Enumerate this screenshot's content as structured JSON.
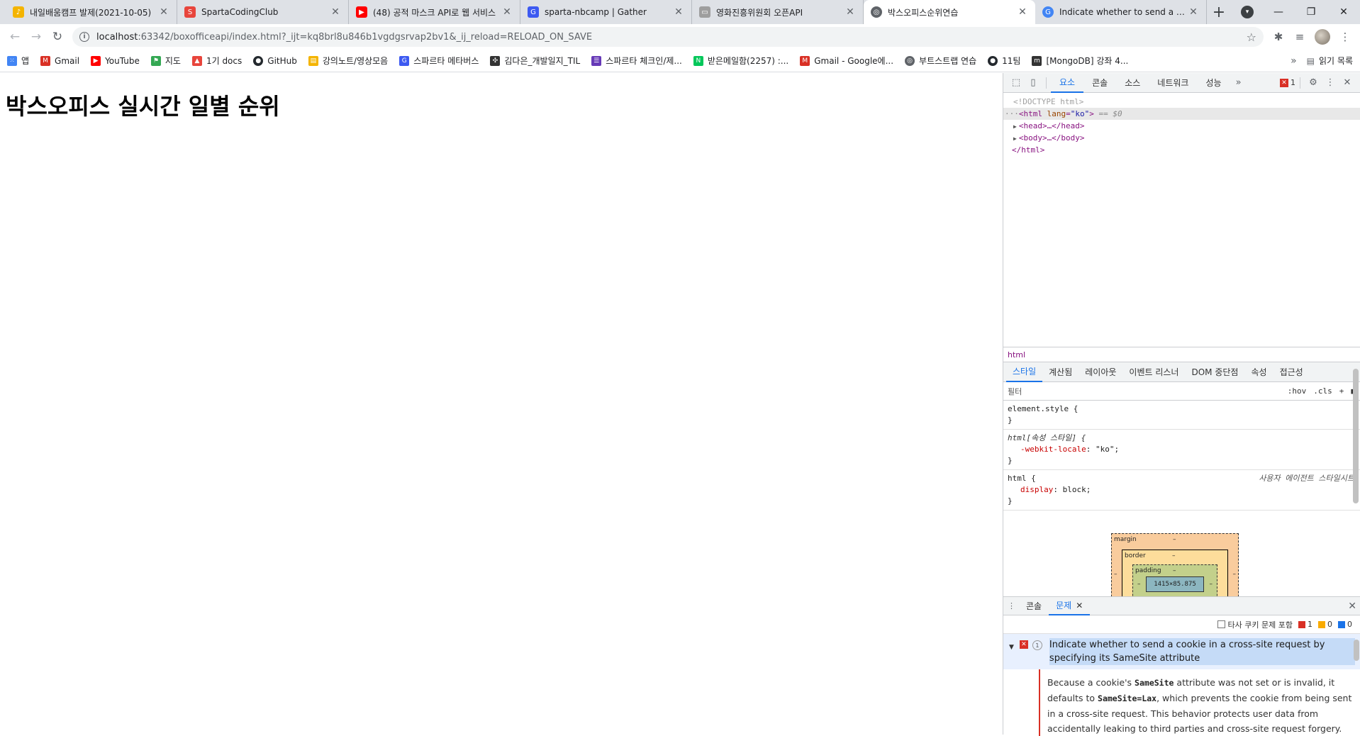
{
  "browser": {
    "tabs": [
      {
        "title": "내일배움캠프 발제(2021-10-05)",
        "color": "#f4b400",
        "glyph": "♪"
      },
      {
        "title": "SpartaCodingClub",
        "color": "#e8453c",
        "glyph": "S"
      },
      {
        "title": "(48) 공적 마스크 API로 웹 서비스",
        "color": "#ff0000",
        "glyph": "▶"
      },
      {
        "title": "sparta-nbcamp | Gather",
        "color": "#3d5af1",
        "glyph": "G"
      },
      {
        "title": "영화진흥위원회 오픈API",
        "color": "#9e9e9e",
        "glyph": "▭"
      },
      {
        "title": "박스오피스순위연습",
        "color": "#5f6368",
        "glyph": "◎"
      },
      {
        "title": "Indicate whether to send a cookie",
        "color": "#4285f4",
        "glyph": "G"
      }
    ],
    "url_host": "localhost",
    "url_rest": ":63342/boxofficeapi/index.html?_ijt=kq8brl8u846b1vgdgsrvap2bv1&_ij_reload=RELOAD_ON_SAVE",
    "bookmarks": [
      {
        "label": "앱",
        "color": "#4285f4"
      },
      {
        "label": "Gmail",
        "color": "#d93025"
      },
      {
        "label": "YouTube",
        "color": "#ff0000"
      },
      {
        "label": "지도",
        "color": "#34a853"
      },
      {
        "label": "1기 docs",
        "color": "#e8453c"
      },
      {
        "label": "GitHub",
        "color": "#24292e"
      },
      {
        "label": "강의노트/영상모음",
        "color": "#f4b400"
      },
      {
        "label": "스파르타 메타버스",
        "color": "#3d5af1"
      },
      {
        "label": "김다은_개발일지_TIL",
        "color": "#333333"
      },
      {
        "label": "스파르타 체크인/제...",
        "color": "#673ab7"
      },
      {
        "label": "받은메일함(2257) :...",
        "color": "#03c75a"
      },
      {
        "label": "Gmail - Google에...",
        "color": "#d93025"
      },
      {
        "label": "부트스트랩 연습",
        "color": "#5f6368"
      },
      {
        "label": "11팀",
        "color": "#24292e"
      },
      {
        "label": "[MongoDB] 강좌 4...",
        "color": "#333333"
      }
    ],
    "reading_list": "읽기 목록"
  },
  "page": {
    "heading": "박스오피스 실시간 일별 순위"
  },
  "devtools": {
    "tabs": [
      "요소",
      "콘솔",
      "소스",
      "네트워크",
      "성능"
    ],
    "error_count": "1",
    "dom": {
      "doctype": "<!DOCTYPE html>",
      "html_open_tag": "html",
      "html_attr": "lang",
      "html_attr_val": "\"ko\"",
      "selected_marker": "== $0",
      "head": "<head>…</head>",
      "body": "<body>…</body>",
      "html_close": "</html>"
    },
    "breadcrumb": "html",
    "style_tabs": [
      "스타일",
      "계산됨",
      "레이아웃",
      "이벤트 리스너",
      "DOM 중단점",
      "속성",
      "접근성"
    ],
    "filter_placeholder": "필터",
    "filter_hov": ":hov",
    "filter_cls": ".cls",
    "rules": {
      "element_style": "element.style {",
      "close": "}",
      "attr_rule": "html[속성 스타일] {",
      "attr_prop": "-webkit-locale",
      "attr_val": "\"ko\";",
      "ua_rule": "html {",
      "ua_source": "사용자 에이전트 스타일시트",
      "ua_prop": "display",
      "ua_val": "block;"
    },
    "boxmodel": {
      "margin": "margin",
      "border": "border",
      "padding": "padding",
      "dash": "–",
      "content": "1415×85.875"
    },
    "drawer": {
      "tabs": [
        "콘솔",
        "문제"
      ],
      "third_party": "타사 쿠키 문제 포함",
      "count_errors": "1",
      "count_warnings": "0",
      "count_info": "0",
      "issue_count": "1",
      "issue_title": "Indicate whether to send a cookie in a cross-site request by specifying its SameSite attribute",
      "body_1": "Because a cookie's",
      "code_1": "SameSite",
      "body_2": "attribute was not set or is invalid, it defaults to",
      "code_2": "SameSite=Lax",
      "body_3": ", which prevents the cookie from being sent in a cross-site request. This behavior protects user data from accidentally leaking to third parties and cross-site request forgery."
    }
  }
}
